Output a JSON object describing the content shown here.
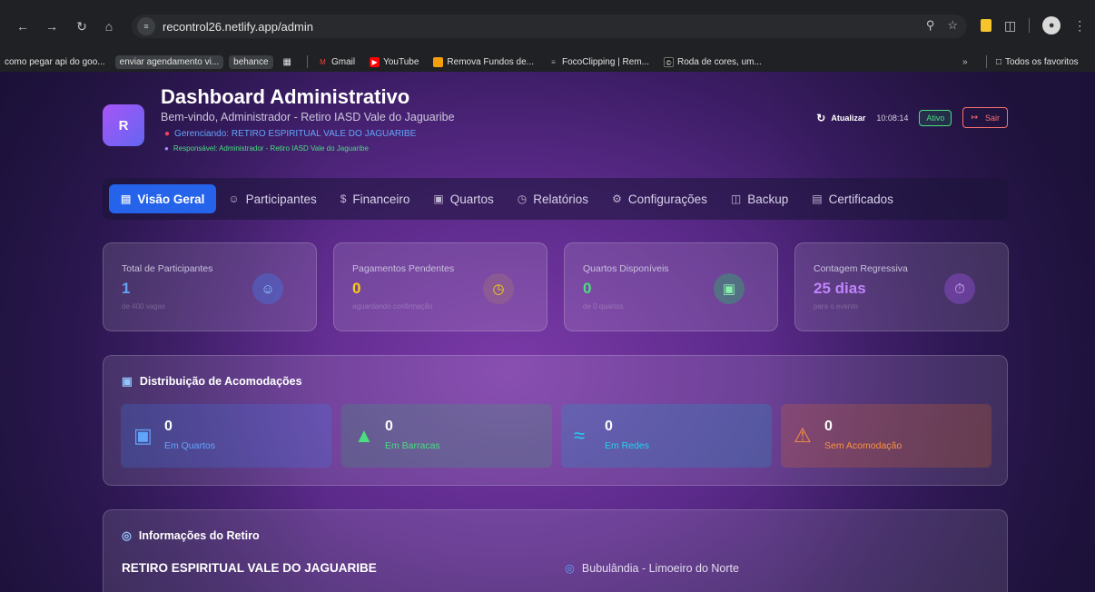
{
  "browser": {
    "url": "recontrol26.netlify.app/admin",
    "bookmarks": [
      {
        "label": "como pegar api do goo...",
        "chip": false
      },
      {
        "label": "enviar agendamento vi...",
        "chip": true
      },
      {
        "label": "behance",
        "chip": true
      },
      {
        "label": "Gmail",
        "chip": false
      },
      {
        "label": "YouTube",
        "chip": false
      },
      {
        "label": "Remova Fundos de...",
        "chip": false
      },
      {
        "label": "FocoClipping | Rem...",
        "chip": false
      },
      {
        "label": "Roda de cores, um...",
        "chip": false
      }
    ],
    "all_bookmarks": "Todos os favoritos"
  },
  "header": {
    "logo_letter": "R",
    "title": "Dashboard Administrativo",
    "subtitle": "Bem-vindo, Administrador - Retiro IASD Vale do Jaguaribe",
    "managing": "Gerenciando: RETIRO ESPIRITUAL VALE DO JAGUARIBE",
    "responsible": "Responsável: Administrador - Retiro IASD Vale do Jaguaribe",
    "refresh_label": "Atualizar",
    "time": "10:08:14",
    "status": "Ativo",
    "exit_label": "Sair"
  },
  "tabs": [
    {
      "label": "Visão Geral",
      "icon": "chart-icon",
      "active": true
    },
    {
      "label": "Participantes",
      "icon": "users-icon"
    },
    {
      "label": "Financeiro",
      "icon": "dollar-icon"
    },
    {
      "label": "Quartos",
      "icon": "bed-icon"
    },
    {
      "label": "Relatórios",
      "icon": "clock-icon"
    },
    {
      "label": "Configurações",
      "icon": "gear-icon"
    },
    {
      "label": "Backup",
      "icon": "database-icon"
    },
    {
      "label": "Certificados",
      "icon": "document-icon"
    }
  ],
  "stats": [
    {
      "label": "Total de Participantes",
      "value": "1",
      "sub": "de 400 vagas",
      "color": "#60a5fa",
      "icon": "users-icon"
    },
    {
      "label": "Pagamentos Pendentes",
      "value": "0",
      "sub": "aguardando confirmação",
      "color": "#facc15",
      "icon": "clock-icon"
    },
    {
      "label": "Quartos Disponíveis",
      "value": "0",
      "sub": "de 0 quartos",
      "color": "#4ade80",
      "icon": "bed-icon"
    },
    {
      "label": "Contagem Regressiva",
      "value": "25 dias",
      "sub": "para o evento",
      "color": "#c084fc",
      "icon": "timer-icon"
    }
  ],
  "accommodation": {
    "title": "Distribuição de Acomodações",
    "items": [
      {
        "value": "0",
        "label": "Em Quartos",
        "color": "#60a5fa",
        "icon": "bed-icon"
      },
      {
        "value": "0",
        "label": "Em Barracas",
        "color": "#4ade80",
        "icon": "tent-icon"
      },
      {
        "value": "0",
        "label": "Em Redes",
        "color": "#22d3ee",
        "icon": "waves-icon"
      },
      {
        "value": "0",
        "label": "Sem Acomodação",
        "color": "#fb923c",
        "icon": "warning-icon"
      }
    ]
  },
  "retreat_info": {
    "title": "Informações do Retiro",
    "name": "RETIRO ESPIRITUAL VALE DO JAGUARIBE",
    "location": "Bubulândia - Limoeiro do Norte"
  }
}
